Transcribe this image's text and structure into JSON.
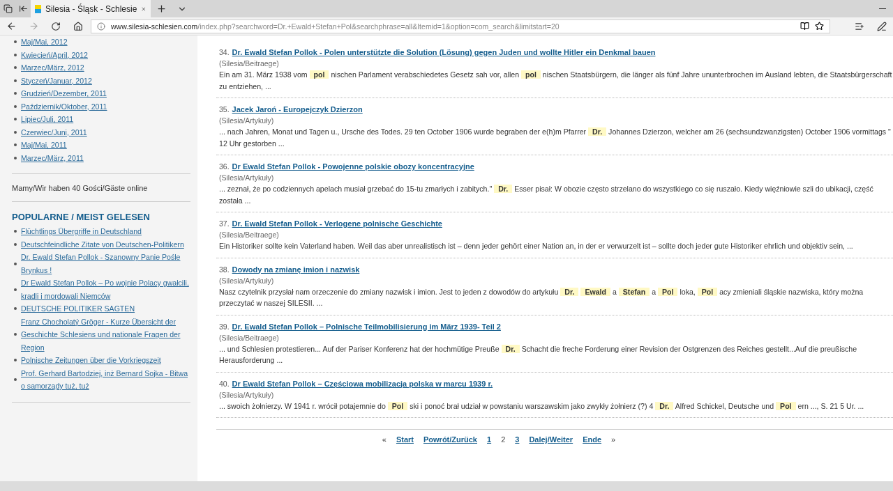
{
  "browser": {
    "tabs": [
      {
        "title": "Silesia - Śląsk - Schlesie",
        "selected": true
      }
    ],
    "url": {
      "domain": "www.silesia-schlesien.com",
      "path": "/index.php?searchword=Dr.+Ewald+Stefan+Pol&searchphrase=all&Itemid=1&option=com_search&limitstart=20"
    }
  },
  "sidebar": {
    "archive": [
      "Maj/Mai, 2012",
      "Kwiecień/April, 2012",
      "Marzec/März, 2012",
      "Styczeń/Januar, 2012",
      "Grudzień/Dezember, 2011",
      "Październik/Oktober, 2011",
      "Lipiec/Juli, 2011",
      "Czerwiec/Juni, 2011",
      "Maj/Mai, 2011",
      "Marzec/März, 2011"
    ],
    "online_text": "Mamy/Wir haben 40 Gości/Gäste online",
    "popular": {
      "heading": "POPULARNE / MEIST GELESEN",
      "items": [
        "Flüchtlings Übergriffe in Deutschland",
        "Deutschfeindliche Zitate von Deutschen-Politikern",
        "Dr. Ewald Stefan Pollok - Szanowny Panie Pośle Brynkus !",
        "Dr Ewald Stefan Pollok – Po wojnie Polacy gwałcili, kradli i mordowali Niemców",
        "DEUTSCHE POLITIKER SAGTEN",
        "Franz Chocholatý Gröger - Kurze Übersicht der Geschichte Schlesiens und nationale Fragen der Region",
        "Polnische Zeitungen über die Vorkriegszeit",
        "Prof. Gerhard Bartodziej, inż Bernard Sojka - Bitwa o samorządy tuż, tuż"
      ]
    }
  },
  "results": [
    {
      "number": "34.",
      "title": "Dr. Ewald Stefan Pollok - Polen unterstützte die Solution (Lösung) gegen Juden und wollte Hitler ein Denkmal bauen",
      "category": "(Silesia/Beitraege)",
      "snippet": "Ein am 31. März 1938 vom **pol** nischen Parlament verabschiedetes Gesetz sah vor, allen **pol** nischen Staatsbürgern, die länger als fünf Jahre ununterbrochen im Ausland lebten, die Staatsbürgerschaft zu entziehen, ..."
    },
    {
      "number": "35.",
      "title": "Jacek Jaroń - Europejczyk Dzierzon",
      "category": "(Silesia/Artykuły)",
      "snippet": "... nach Jahren, Monat und Tagen u., Ursche des Todes. 29 ten October 1906 wurde begraben der  e(h)m Pfarrer **Dr.** Johannes Dzierzon, welcher  am 26 (sechsundzwanzigsten) October  1906 vormittags \" 12 Uhr gestorben ..."
    },
    {
      "number": "36.",
      "title": "Dr Ewald Stefan Pollok - Powojenne polskie obozy koncentracyjne",
      "category": "(Silesia/Artykuły)",
      "snippet": "... zeznał, że po codziennych apelach musiał grzebać do 15-tu zmarłych i zabitych.\" **Dr.** Esser pisał: W obozie często strzelano do wszystkiego co się ruszało. Kiedy więźniowie szli do ubikacji, część została ..."
    },
    {
      "number": "37.",
      "title": "Dr. Ewald Stefan Pollok - Verlogene polnische Geschichte",
      "category": "(Silesia/Beitraege)",
      "snippet": "Ein Historiker sollte kein Vaterland haben. Weil das aber unrealistisch ist – denn jeder gehört einer Nation an, in der er verwurzelt ist – sollte doch jeder gute Historiker ehrlich und objektiv sein, ..."
    },
    {
      "number": "38.",
      "title": "Dowody na zmianę imion i nazwisk",
      "category": "(Silesia/Artykuły)",
      "snippet": "Nasz czytelnik przysłał nam orzeczenie do zmiany nazwisk i imion. Jest to jeden z dowodów do artykułu **Dr.** **Ewald** a **Stefan** a **Pol** loka, **Pol** acy zmieniali śląskie nazwiska, który można  przeczytać w naszej SILESII. ..."
    },
    {
      "number": "39.",
      "title": "Dr. Ewald Stefan Pollok – Polnische Teilmobilisierung im März 1939- Teil 2",
      "category": "(Silesia/Beitraege)",
      "snippet": "... und Schlesien protestieren... Auf der Pariser Konferenz hat der hochmütige Preuße **Dr.** Schacht die freche Forderung einer Revision der Ostgrenzen des Reiches gestellt...Auf die preußische Herausforderung ..."
    },
    {
      "number": "40.",
      "title": "Dr Ewald Stefan Pollok – Częściowa mobilizacja polska w marcu 1939 r.",
      "category": "(Silesia/Artykuły)",
      "snippet": "... swoich żołnierzy. W 1941 r. wrócił potajemnie do **Pol** ski i ponoć brał udział w powstaniu warszawskim jako zwykły żołnierz (?) 4 **Dr.** Alfred Schickel, Deutsche und **Pol** ern ..., S. 21 5 Ur. ..."
    }
  ],
  "pagination": [
    {
      "label": "«",
      "kind": "arrow"
    },
    {
      "label": "Start",
      "kind": "link"
    },
    {
      "label": "Powrót/Zurück",
      "kind": "link"
    },
    {
      "label": "1",
      "kind": "link"
    },
    {
      "label": "2",
      "kind": "current"
    },
    {
      "label": "3",
      "kind": "link"
    },
    {
      "label": "Dalej/Weiter",
      "kind": "link"
    },
    {
      "label": "Ende",
      "kind": "link"
    },
    {
      "label": "»",
      "kind": "arrow"
    }
  ]
}
